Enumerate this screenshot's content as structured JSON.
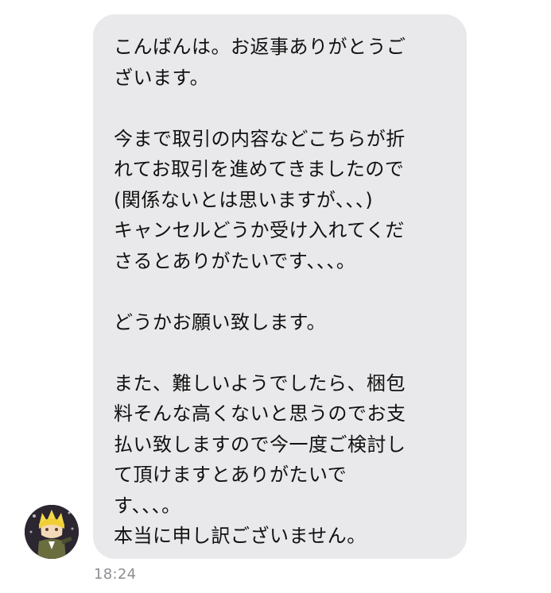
{
  "conversation": {
    "message": {
      "lines": [
        "こんばんは。お返事ありがとうご",
        "ざいます。",
        "",
        "今まで取引の内容などこちらが折",
        "れてお取引を進めてきましたので",
        "(関係ないとは思いますが、、、)",
        "キャンセルどうか受け入れてくだ",
        "さるとありがたいです、、、。",
        "",
        "どうかお願い致します。",
        "",
        "また、難しいようでしたら、梱包",
        "料そんな高くないと思うのでお支",
        "払い致しますので今一度ご検討し",
        "て頂けますとありがたいで",
        "す、、、。",
        "本当に申し訳ございません。"
      ],
      "timestamp": "18:24"
    },
    "sender": {
      "avatar_icon": "anime-character-avatar"
    }
  },
  "colors": {
    "bubble_background": "#e9e9eb",
    "text": "#111111",
    "timestamp": "#8e8e93"
  }
}
